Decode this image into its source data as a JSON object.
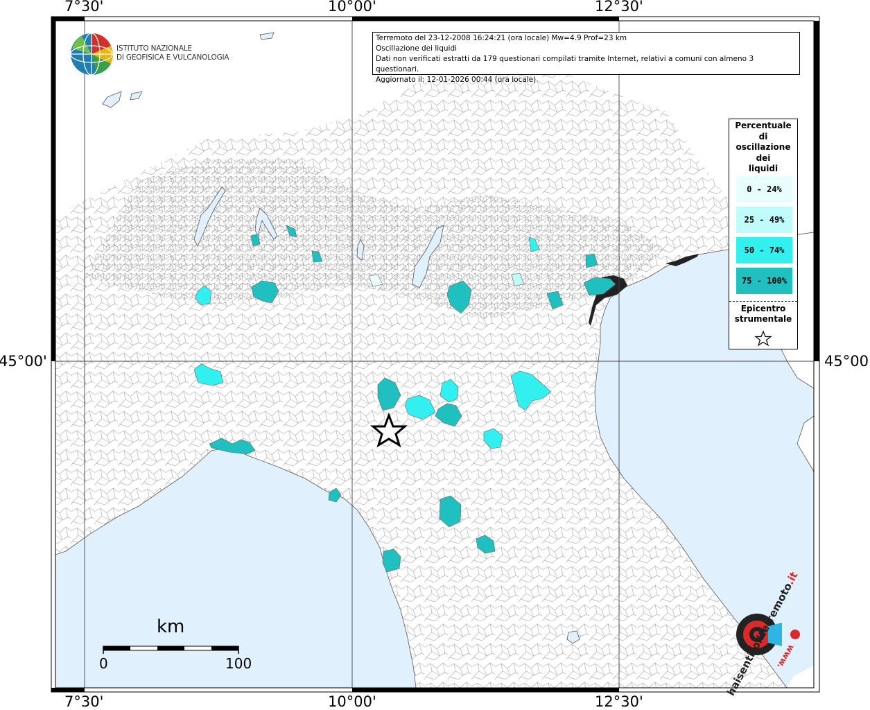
{
  "coords": {
    "top": [
      "7°30'",
      "10°00'",
      "12°30'"
    ],
    "bottom": [
      "7°30'",
      "10°00'",
      "12°30'"
    ],
    "left": "45°00'",
    "right": "45°00'"
  },
  "logo": {
    "line1": "ISTITUTO NAZIONALE",
    "line2": "DI GEOFISICA E VULCANOLOGIA"
  },
  "info": {
    "line1": "Terremoto del 23-12-2008 16:24:21 (ora locale) Mw=4.9 Prof=23 km",
    "line2": "Oscillazione dei liquidi",
    "line3": "Dati non verificati estratti da 179 questionari compilati tramite Internet, relativi a comuni con almeno 3 questionari.",
    "line4": "Aggiornato il: 12-01-2026 00:44 (ora locale)"
  },
  "legend": {
    "title_lines": [
      "Percentuale",
      "di",
      "oscillazione",
      "dei",
      "liquidi"
    ],
    "classes": [
      {
        "label": "0 - 24%",
        "color": "#e8fefe"
      },
      {
        "label": "25 - 49%",
        "color": "#bffbfb"
      },
      {
        "label": "50 - 74%",
        "color": "#33f0f0"
      },
      {
        "label": "75 - 100%",
        "color": "#20c0c0"
      }
    ],
    "epicenter_lines": [
      "Epicentro",
      "strumentale"
    ]
  },
  "scale": {
    "unit": "km",
    "min": "0",
    "max": "100"
  },
  "watermark": {
    "text_main": "haisentitoilterremoto",
    "text_suffix": ".it",
    "text_www": "www."
  },
  "colors": {
    "sea": "#e0f0fc",
    "land": "#ffffff",
    "border": "#9a9a9a"
  }
}
